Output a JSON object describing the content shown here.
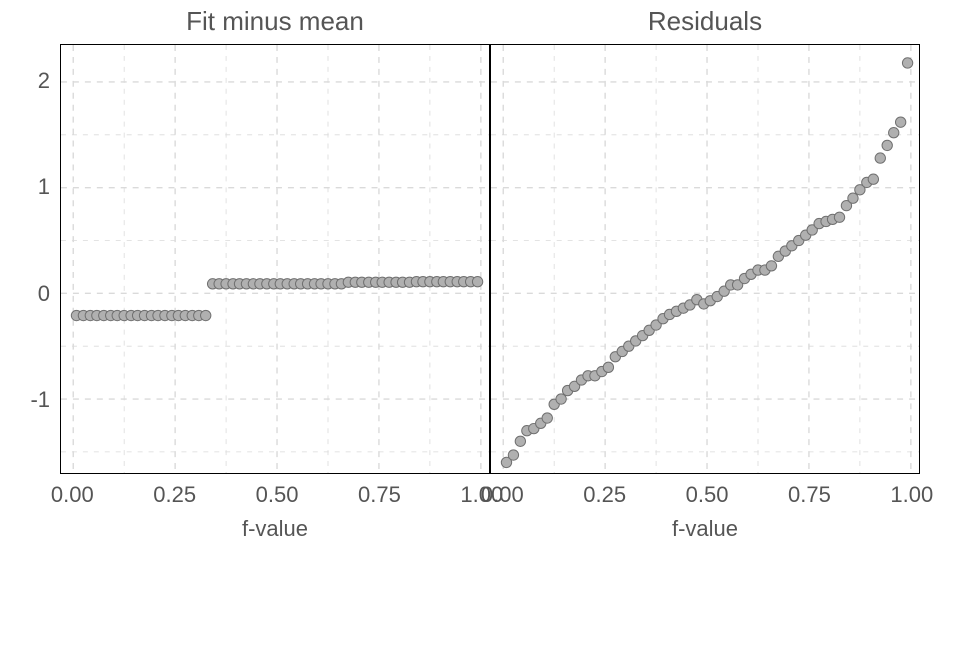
{
  "y_ticks": [
    -1,
    0,
    1,
    2
  ],
  "x_ticks": [
    0.0,
    0.25,
    0.5,
    0.75,
    1.0
  ],
  "ylim": [
    -1.7,
    2.35
  ],
  "xlim": [
    -0.03,
    1.02
  ],
  "point": {
    "fill": "#b0b0b0",
    "stroke": "#707070",
    "r": 5.2
  },
  "grid_color": "#dadada",
  "chart_data": [
    {
      "type": "scatter",
      "title": "Fit minus mean",
      "xlabel": "f-value",
      "ylabel": "",
      "xlim": [
        -0.03,
        1.02
      ],
      "ylim": [
        -1.7,
        2.35
      ],
      "x": [
        0.008,
        0.025,
        0.042,
        0.058,
        0.075,
        0.092,
        0.108,
        0.125,
        0.142,
        0.158,
        0.175,
        0.192,
        0.208,
        0.225,
        0.242,
        0.258,
        0.275,
        0.292,
        0.308,
        0.325,
        0.342,
        0.358,
        0.375,
        0.392,
        0.408,
        0.425,
        0.442,
        0.458,
        0.475,
        0.492,
        0.508,
        0.525,
        0.542,
        0.558,
        0.575,
        0.592,
        0.608,
        0.625,
        0.642,
        0.658,
        0.675,
        0.692,
        0.708,
        0.725,
        0.742,
        0.758,
        0.775,
        0.792,
        0.808,
        0.825,
        0.842,
        0.858,
        0.875,
        0.892,
        0.908,
        0.925,
        0.942,
        0.958,
        0.975,
        0.992
      ],
      "y": [
        -0.21,
        -0.21,
        -0.21,
        -0.21,
        -0.21,
        -0.21,
        -0.21,
        -0.21,
        -0.21,
        -0.21,
        -0.21,
        -0.21,
        -0.21,
        -0.21,
        -0.21,
        -0.21,
        -0.21,
        -0.21,
        -0.21,
        -0.21,
        0.09,
        0.09,
        0.09,
        0.09,
        0.09,
        0.09,
        0.09,
        0.09,
        0.09,
        0.09,
        0.09,
        0.09,
        0.09,
        0.09,
        0.09,
        0.09,
        0.09,
        0.09,
        0.09,
        0.09,
        0.105,
        0.105,
        0.105,
        0.105,
        0.105,
        0.105,
        0.105,
        0.105,
        0.105,
        0.105,
        0.11,
        0.11,
        0.11,
        0.11,
        0.11,
        0.11,
        0.11,
        0.11,
        0.11,
        0.11
      ]
    },
    {
      "type": "scatter",
      "title": "Residuals",
      "xlabel": "f-value",
      "ylabel": "",
      "xlim": [
        -0.03,
        1.02
      ],
      "ylim": [
        -1.7,
        2.35
      ],
      "x": [
        0.008,
        0.025,
        0.042,
        0.058,
        0.075,
        0.092,
        0.108,
        0.125,
        0.142,
        0.158,
        0.175,
        0.192,
        0.208,
        0.225,
        0.242,
        0.258,
        0.275,
        0.292,
        0.308,
        0.325,
        0.342,
        0.358,
        0.375,
        0.392,
        0.408,
        0.425,
        0.442,
        0.458,
        0.475,
        0.492,
        0.508,
        0.525,
        0.542,
        0.558,
        0.575,
        0.592,
        0.608,
        0.625,
        0.642,
        0.658,
        0.675,
        0.692,
        0.708,
        0.725,
        0.742,
        0.758,
        0.775,
        0.792,
        0.808,
        0.825,
        0.842,
        0.858,
        0.875,
        0.892,
        0.908,
        0.925,
        0.942,
        0.958,
        0.975,
        0.992
      ],
      "y": [
        -1.6,
        -1.53,
        -1.4,
        -1.3,
        -1.28,
        -1.23,
        -1.18,
        -1.05,
        -1.0,
        -0.92,
        -0.88,
        -0.82,
        -0.78,
        -0.78,
        -0.74,
        -0.7,
        -0.6,
        -0.55,
        -0.5,
        -0.45,
        -0.4,
        -0.35,
        -0.3,
        -0.24,
        -0.2,
        -0.17,
        -0.14,
        -0.11,
        -0.06,
        -0.1,
        -0.07,
        -0.03,
        0.02,
        0.08,
        0.08,
        0.14,
        0.18,
        0.22,
        0.22,
        0.26,
        0.35,
        0.4,
        0.45,
        0.5,
        0.55,
        0.6,
        0.66,
        0.68,
        0.7,
        0.72,
        0.83,
        0.9,
        0.98,
        1.05,
        1.08,
        1.28,
        1.4,
        1.52,
        1.62,
        2.18
      ]
    }
  ]
}
